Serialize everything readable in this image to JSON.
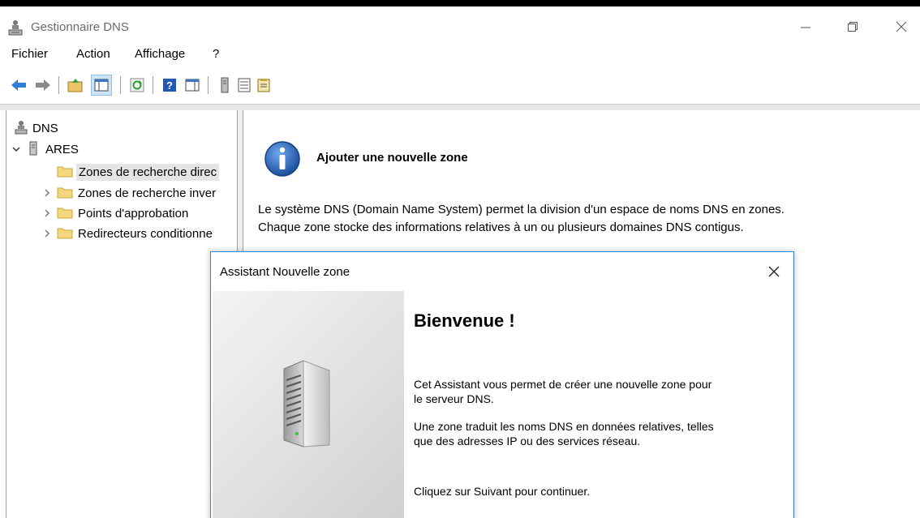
{
  "window": {
    "title": "Gestionnaire DNS",
    "icon": "dns-manager-icon"
  },
  "menu": [
    "Fichier",
    "Action",
    "Affichage",
    "?"
  ],
  "toolbar": {
    "buttons": [
      "back-arrow",
      "forward-arrow",
      "up-folder",
      "show-hide-console-tree",
      "refresh",
      "help",
      "export-list",
      "server",
      "list",
      "properties"
    ]
  },
  "tree": {
    "root": "DNS",
    "server": "ARES",
    "items": [
      "Zones de recherche direc",
      "Zones de recherche inver",
      "Points d'approbation",
      "Redirecteurs conditionne"
    ]
  },
  "content": {
    "info_title": "Ajouter une nouvelle zone",
    "info_line1": "Le système DNS (Domain Name System) permet la division d'un espace de noms DNS en zones.",
    "info_line2": "Chaque zone stocke des informations relatives à un ou plusieurs domaines DNS contigus."
  },
  "dialog": {
    "title": "Assistant Nouvelle zone",
    "heading": "Bienvenue !",
    "para1_line1": "Cet Assistant vous permet de créer une nouvelle zone pour",
    "para1_line2": "le serveur DNS.",
    "para2_line1": "Une zone traduit les noms DNS en données relatives, telles",
    "para2_line2": "que des adresses IP ou des services réseau.",
    "para3": "Cliquez sur Suivant pour continuer."
  },
  "colors": {
    "accent": "#2b88d8",
    "selection": "#e5e5e5",
    "folder": "#f3d77c"
  }
}
